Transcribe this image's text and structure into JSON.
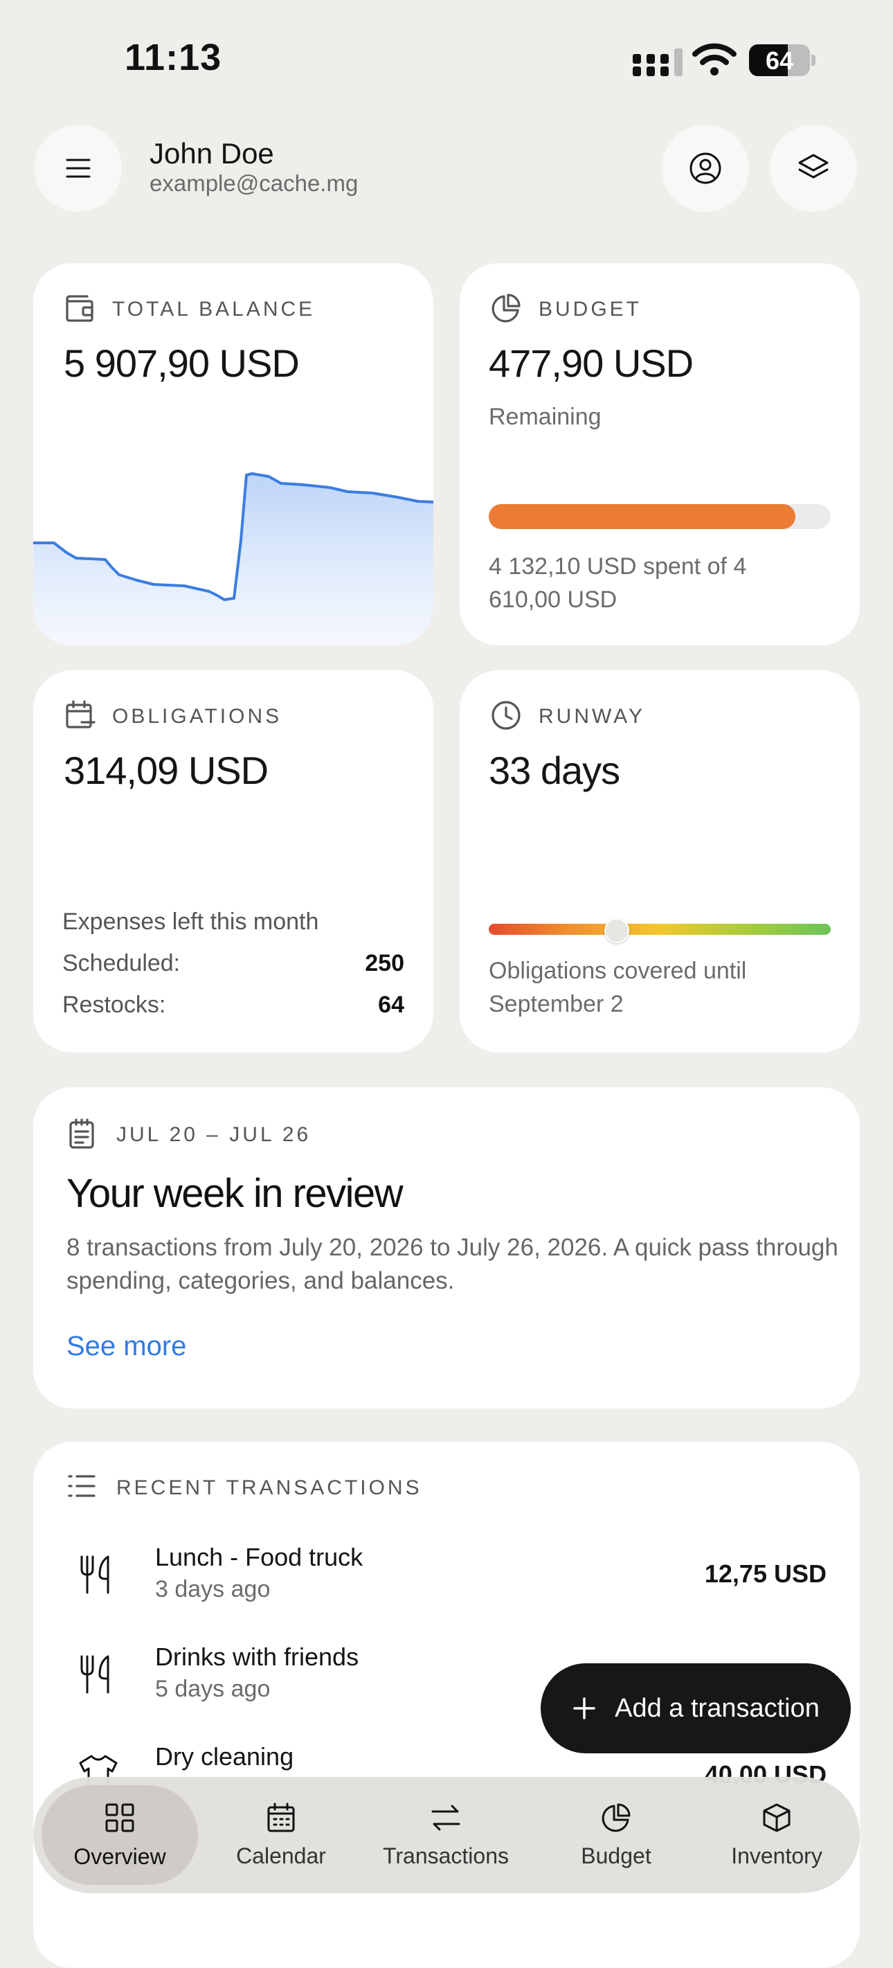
{
  "status_bar": {
    "time": "11:13",
    "battery_level": "64",
    "battery_fraction": 0.64
  },
  "header": {
    "user_name": "John Doe",
    "user_email": "example@cache.mg",
    "menu_icon": "menu-icon",
    "profile_icon": "user-circle-icon",
    "layers_icon": "layers-icon"
  },
  "cards": {
    "total_balance": {
      "label": "TOTAL BALANCE",
      "value": "5 907,90 USD",
      "icon": "wallet-icon"
    },
    "budget": {
      "label": "BUDGET",
      "value": "477,90 USD",
      "sub": "Remaining",
      "spent_text": "4 132,10 USD spent of 4 610,00 USD",
      "progress_fraction": 0.896,
      "bar_color": "#ec7b34",
      "icon": "pie-chart-icon"
    },
    "obligations": {
      "label": "OBLIGATIONS",
      "value": "314,09 USD",
      "note": "Expenses left this month",
      "rows": [
        {
          "label": "Scheduled:",
          "value": "250"
        },
        {
          "label": "Restocks:",
          "value": "64"
        }
      ],
      "icon": "calendar-minus-icon"
    },
    "runway": {
      "label": "RUNWAY",
      "value": "33 days",
      "note": "Obligations covered until September 2",
      "slider_fraction": 0.37,
      "icon": "clock-icon"
    }
  },
  "week_review": {
    "range": "JUL 20 – JUL 26",
    "title": "Your week in review",
    "description": "8 transactions from July 20, 2026 to July 26, 2026. A quick pass through spending, categories, and balances.",
    "link": "See more",
    "icon": "notepad-icon"
  },
  "recent_transactions": {
    "label": "RECENT TRANSACTIONS",
    "icon": "list-icon",
    "items": [
      {
        "name": "Lunch - Food truck",
        "when": "3 days ago",
        "amount": "12,75 USD",
        "icon": "utensils-icon"
      },
      {
        "name": "Drinks with friends",
        "when": "5 days ago",
        "amount": "",
        "icon": "utensils-icon"
      },
      {
        "name": "Dry cleaning",
        "when": "",
        "amount": "40,00 USD",
        "icon": "shirt-icon"
      }
    ]
  },
  "fab": {
    "label": "Add a transaction",
    "icon": "plus-icon"
  },
  "bottom_nav": {
    "items": [
      {
        "label": "Overview",
        "icon": "grid-icon",
        "active": true
      },
      {
        "label": "Calendar",
        "icon": "calendar-icon",
        "active": false
      },
      {
        "label": "Transactions",
        "icon": "arrows-icon",
        "active": false
      },
      {
        "label": "Budget",
        "icon": "pie-chart-icon",
        "active": false
      },
      {
        "label": "Inventory",
        "icon": "box-icon",
        "active": false
      }
    ]
  },
  "colors": {
    "accent_link": "#2f7be6",
    "chart_line": "#3b7de0",
    "background": "#efeeeb"
  }
}
